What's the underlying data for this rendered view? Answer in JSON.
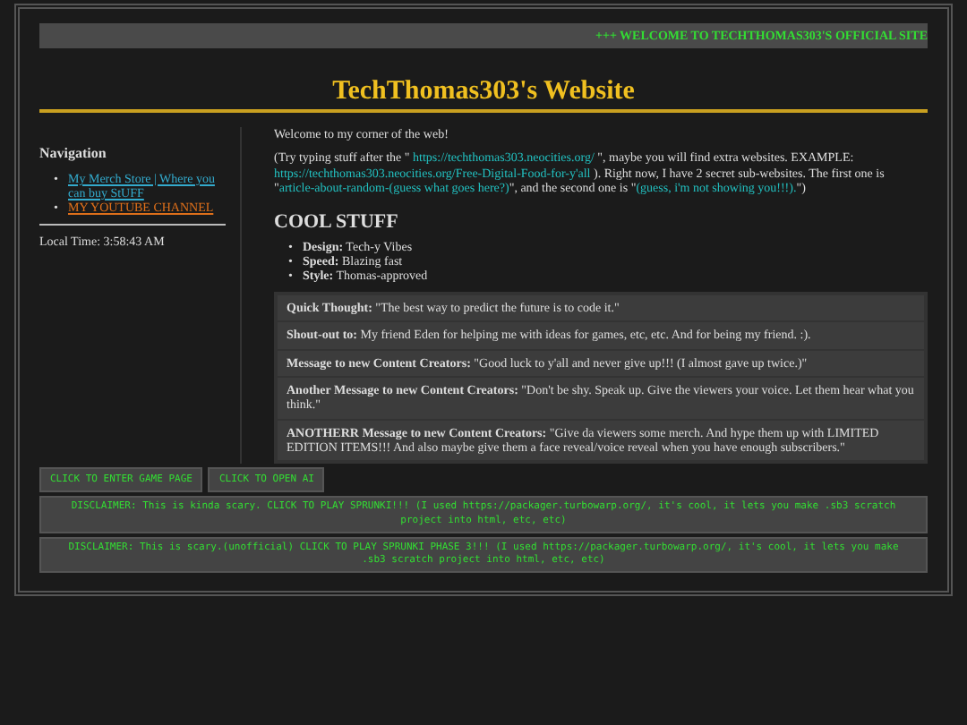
{
  "marquee": "+++ WELCOME TO TECHTHOMAS303'S OFFICIAL SITE",
  "title": "TechThomas303's Website",
  "sidebar": {
    "heading": "Navigation",
    "links": [
      {
        "bullet": "•",
        "label": "My Merch Store | Where you can buy StUFF",
        "kind": "merch"
      },
      {
        "bullet": "•",
        "label": "MY YOUTUBE CHANNEL",
        "kind": "youtube"
      }
    ],
    "local_time": "Local Time: 3:58:43 AM"
  },
  "intro": "Welcome to my corner of the web!",
  "paragraph": [
    {
      "kind": "text",
      "text": "(Try typing stuff after the \" "
    },
    {
      "kind": "link",
      "text": "https://techthomas303.neocities.org/"
    },
    {
      "kind": "text",
      "text": " \", maybe you will find extra websites. EXAMPLE: "
    },
    {
      "kind": "link",
      "text": "https://techthomas303.neocities.org/Free-Digital-Food-for-y'all"
    },
    {
      "kind": "text",
      "text": " ). Right now, I have 2 secret sub-websites. The first one is \""
    },
    {
      "kind": "link",
      "text": "article-about-random-(guess what goes here?)"
    },
    {
      "kind": "text",
      "text": "\", and the second one is \""
    },
    {
      "kind": "link",
      "text": "(guess, i'm not showing you!!!)."
    },
    {
      "kind": "text",
      "text": "\")"
    }
  ],
  "section_heading": "COOL STUFF",
  "features": [
    {
      "bullet": "•",
      "label": "Design:",
      "value": "Tech-y Vibes"
    },
    {
      "bullet": "•",
      "label": "Speed:",
      "value": "Blazing fast"
    },
    {
      "bullet": "•",
      "label": "Style:",
      "value": "Thomas-approved"
    }
  ],
  "messages": [
    {
      "text": "**Quick Thought:** \"The best way to predict the future is to code it.\""
    },
    {
      "text": "**Shout-out to:** My friend Eden for helping me with ideas for games, etc, etc. And for being my friend. :)."
    },
    {
      "text": "**Message to new Content Creators:** \"Good luck to y'all and never give up!!! (I almost gave up twice.)\""
    },
    {
      "text": "**Another Message to new Content Creators:** \"Don't be shy. Speak up. Give the viewers your voice. Let them hear what you think.\""
    },
    {
      "text": "**ANOTHERR Message to new Content Creators:** \"Give da viewers some merch. And hype them up with LIMITED EDITION ITEMS!!! And also maybe give them a face reveal/voice reveal when you have enough subscribers.\""
    }
  ],
  "buttons": [
    "CLICK TO ENTER GAME PAGE",
    "CLICK TO OPEN AI"
  ],
  "disclaimers": [
    "DISCLAIMER: This is kinda scary. CLICK TO PLAY SPRUNKI!!! (I used https://packager.turbowarp.org/, it's cool, it lets you make .sb3 scratch project into html, etc, etc)",
    "DISCLAIMER: This is scary.(unofficial) CLICK TO PLAY SPRUNKI PHASE 3!!! (I used https://packager.turbowarp.org/, it's cool, it lets you make .sb3 scratch project into html, etc, etc)"
  ]
}
